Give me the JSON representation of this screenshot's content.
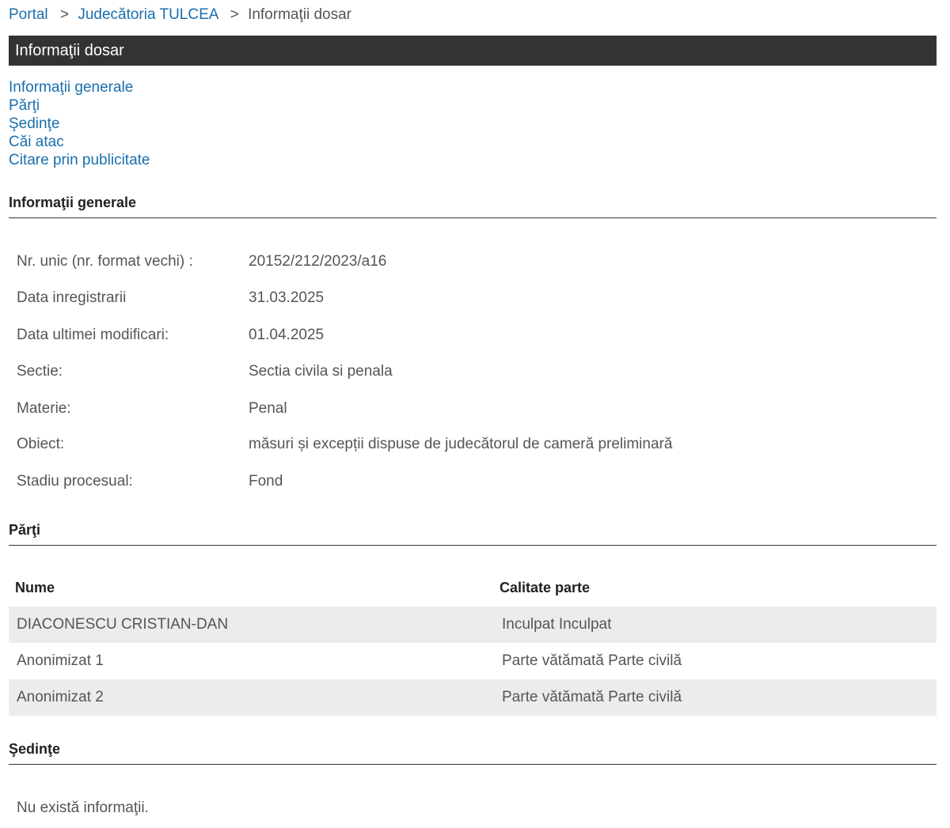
{
  "breadcrumb": {
    "items": [
      "Portal",
      "Judecătoria TULCEA"
    ],
    "current": "Informaţii dosar",
    "separator": ">"
  },
  "title_bar": {
    "title": "Informaţii dosar"
  },
  "toc": {
    "links": [
      "Informaţii generale",
      "Părţi",
      "Şedinţe",
      "Căi atac",
      "Citare prin publicitate"
    ]
  },
  "general": {
    "heading": "Informaţii generale",
    "rows": [
      {
        "label": "Nr. unic (nr. format vechi) :",
        "value": "20152/212/2023/a16"
      },
      {
        "label": "Data inregistrarii",
        "value": "31.03.2025"
      },
      {
        "label": "Data ultimei modificari:",
        "value": "01.04.2025"
      },
      {
        "label": "Sectie:",
        "value": "Sectia civila si penala"
      },
      {
        "label": "Materie:",
        "value": "Penal"
      },
      {
        "label": "Obiect:",
        "value": "măsuri și excepții dispuse de judecătorul de cameră preliminară"
      },
      {
        "label": "Stadiu procesual:",
        "value": "Fond"
      }
    ]
  },
  "parti": {
    "heading": "Părţi",
    "columns": [
      "Nume",
      "Calitate parte"
    ],
    "rows": [
      [
        "DIACONESCU CRISTIAN-DAN",
        "Inculpat Inculpat"
      ],
      [
        "Anonimizat 1",
        "Parte vătămată Parte civilă"
      ],
      [
        "Anonimizat 2",
        "Parte vătămată Parte civilă"
      ]
    ]
  },
  "sedinte": {
    "heading": "Şedinţe",
    "empty_message": "Nu există informaţii."
  },
  "colors": {
    "link": "#1a6fad",
    "title_bar_bg": "#333333",
    "row_shade": "#ececec",
    "text": "#555555"
  }
}
